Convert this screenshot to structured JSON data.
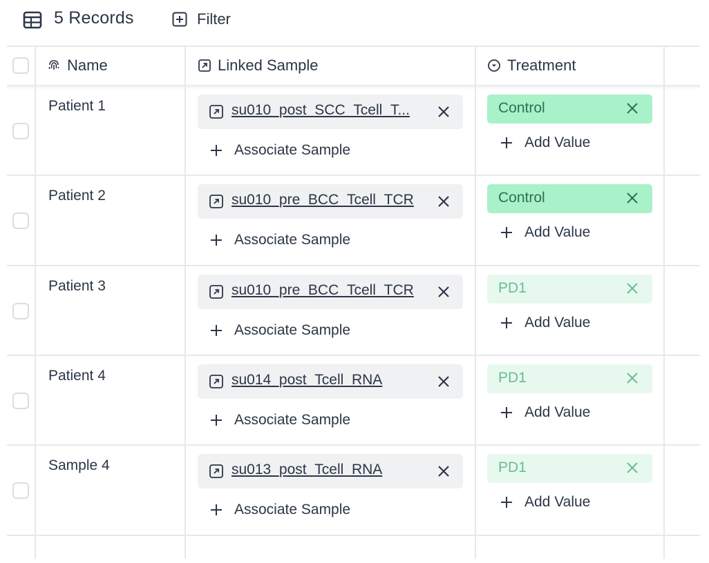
{
  "toolbar": {
    "records_label": "5 Records",
    "filter_label": "Filter"
  },
  "columns": {
    "name": "Name",
    "linked_sample": "Linked Sample",
    "treatment": "Treatment"
  },
  "rows": [
    {
      "name": "Patient 1",
      "sample": "su010_post_SCC_Tcell_T...",
      "treatment": "Control",
      "treatment_style": "control"
    },
    {
      "name": "Patient 2",
      "sample": "su010_pre_BCC_Tcell_TCR",
      "treatment": "Control",
      "treatment_style": "control"
    },
    {
      "name": "Patient 3",
      "sample": "su010_pre_BCC_Tcell_TCR",
      "treatment": "PD1",
      "treatment_style": "pd1"
    },
    {
      "name": "Patient 4",
      "sample": "su014_post_Tcell_RNA",
      "treatment": "PD1",
      "treatment_style": "pd1"
    },
    {
      "name": "Sample 4",
      "sample": "su013_post_Tcell_RNA",
      "treatment": "PD1",
      "treatment_style": "pd1"
    }
  ],
  "actions": {
    "associate_label": "Associate Sample",
    "add_value_label": "Add Value"
  },
  "colors": {
    "control_bg": "#a9f1c9",
    "control_text": "#2f6f55",
    "pd1_bg": "#e7f9ee",
    "pd1_text": "#6dba96",
    "grid": "#e6e8eb"
  },
  "icons": {
    "records": "table-icon",
    "filter": "plus-square-icon",
    "name_column": "fingerprint-icon",
    "linked_sample_column": "external-link-icon",
    "treatment_column": "chevron-circle-icon",
    "sample_link": "external-link-icon",
    "remove": "close-icon",
    "add": "plus-icon"
  }
}
